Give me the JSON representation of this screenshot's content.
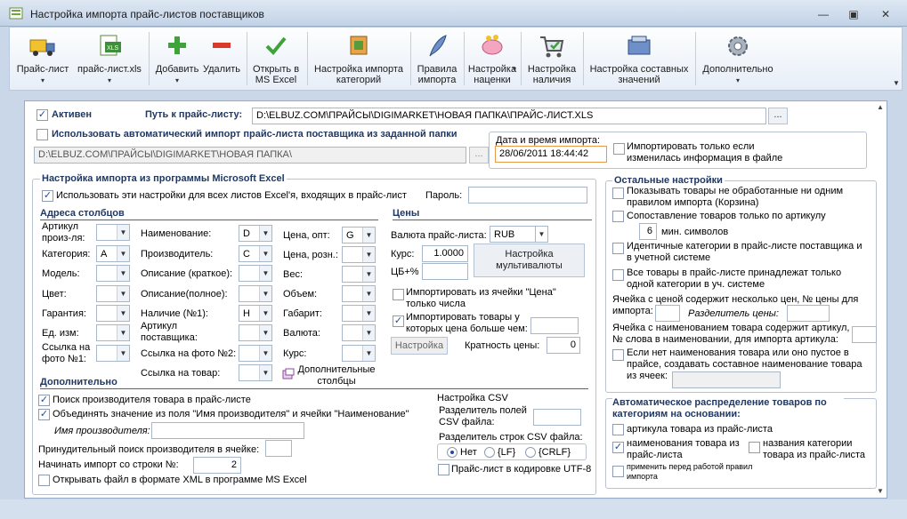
{
  "window": {
    "title": "Настройка импорта прайс-листов поставщиков",
    "min": "—",
    "restore": "▣",
    "close": "✕"
  },
  "toolbar": {
    "items": [
      {
        "label": "Прайс-лист",
        "arrow": "▾",
        "icon": "truck-icon"
      },
      {
        "label": "прайс-лист.xls",
        "arrow": "▾",
        "icon": "excel-icon"
      },
      {
        "label": "Добавить",
        "arrow": "▾",
        "icon": "plus-icon"
      },
      {
        "label": "Удалить",
        "arrow": "",
        "icon": "minus-icon"
      },
      {
        "label": "Открыть в MS Excel",
        "arrow": "",
        "icon": "check-icon"
      },
      {
        "label": "Настройка импорта категорий",
        "arrow": "",
        "icon": "categories-icon"
      },
      {
        "label": "Правила импорта",
        "arrow": "",
        "icon": "feather-icon"
      },
      {
        "label": "Настройка наценки",
        "arrow": "▾",
        "icon": "piggy-bank-icon"
      },
      {
        "label": "Настройка наличия",
        "arrow": "",
        "icon": "cart-icon"
      },
      {
        "label": "Настройка составных значений",
        "arrow": "",
        "icon": "wallet-icon"
      },
      {
        "label": "Дополнительно",
        "arrow": "▾",
        "icon": "gear-icon"
      }
    ]
  },
  "top": {
    "active_label": "Активен",
    "path_label": "Путь к прайс-листу:",
    "path_value": "D:\\ELBUZ.COM\\ПРАЙСЫ\\DIGIMARKET\\НОВАЯ ПАПКА\\ПРАЙС-ЛИСТ.XLS",
    "browse": "...",
    "auto_import_label": "Использовать автоматический импорт прайс-листа поставщика из заданной папки",
    "folder_value": "D:\\ELBUZ.COM\\ПРАЙСЫ\\DIGIMARKET\\НОВАЯ ПАПКА\\",
    "datetime_label": "Дата и время импорта:",
    "datetime_value": "28/06/2011 18:44:42",
    "only_changed_label": "Импортировать только если изменилась информация в файле"
  },
  "excel": {
    "title": "Настройка импорта из программы Microsoft Excel",
    "use_for_all_label": "Использовать эти настройки для всех листов Excel'я, входящих в прайс-лист",
    "password_label": "Пароль:",
    "addresses_title": "Адреса столбцов",
    "fields": {
      "article": "Артикул произ-ля:",
      "category": "Категория:",
      "category_val": "A",
      "model": "Модель:",
      "color": "Цвет:",
      "warranty": "Гарантия:",
      "unit": "Ед. изм:",
      "photo_link": "Ссылка на фото №1:",
      "name": "Наименование:",
      "name_val": "D",
      "manufacturer": "Производитель:",
      "manufacturer_val": "C",
      "desc_short": "Описание (краткое):",
      "desc_full": "Описание(полное):",
      "availability": "Наличие (№1):",
      "availability_val": "H",
      "supplier_article": "Артикул поставщика:",
      "photo_link2": "Ссылка на фото №2:",
      "product_link": "Ссылка на товар:",
      "price_opt": "Цена, опт:",
      "price_opt_val": "G",
      "price_retail": "Цена, розн.:",
      "weight": "Вес:",
      "volume": "Объем:",
      "dimensions": "Габарит:",
      "currency": "Валюта:",
      "rate": "Курс:",
      "extra_columns": "Дополнительные столбцы"
    },
    "prices": {
      "title": "Цены",
      "currency_label": "Валюта прайс-листа:",
      "currency_value": "RUB",
      "rate_label": "Курс:",
      "rate_value": "1.0000",
      "cb_label": "ЦБ+%",
      "multi_currency_button": "Настройка мультивалюты",
      "import_from_cell_label": "Импортировать из ячейки \"Цена\" только числа",
      "import_price_gt_label": "Импортировать товары у которых цена больше чем:",
      "setting_button": "Настройка",
      "multiplicity_label": "Кратность цены:",
      "multiplicity_value": "0"
    }
  },
  "additional": {
    "title": "Дополнительно",
    "find_manufacturer_label": "Поиск производителя товара в прайс-листе",
    "merge_label": "Объединять значение из поля \"Имя производителя\" и ячейки \"Наименование\"",
    "manufacturer_name_label": "Имя производителя:",
    "forced_search_label": "Принудительный поиск производителя в ячейке:",
    "start_row_label": "Начинать импорт со строки №:",
    "start_row_value": "2",
    "xml_label": "Открывать файл в формате XML в программе MS Excel"
  },
  "csv": {
    "title": "Настройка CSV",
    "field_sep_label": "Разделитель полей CSV файла:",
    "row_sep_label": "Разделитель строк CSV файла:",
    "opt_none": "Нет",
    "opt_lf": "{LF}",
    "opt_crlf": "{CRLF}",
    "utf8_label": "Прайс-лист в кодировке UTF-8"
  },
  "other": {
    "title": "Остальные настройки",
    "show_unprocessed_label": "Показывать товары не обработанные ни одним правилом импорта (Корзина)",
    "match_article_label": "Сопоставление товаров только по артикулу",
    "min_symbols_value": "6",
    "min_symbols_label": "мин. символов",
    "identical_categories_label": "Идентичные категории в прайс-листе поставщика и в учетной системе",
    "all_one_category_label": "Все товары в прайс-листе принадлежат только одной категории в уч. системе",
    "multi_price_label": "Ячейка с ценой содержит несколько цен, № цены для импорта:",
    "price_separator_label": "Разделитель цены:",
    "name_contains_article_label": "Ячейка с наименованием товара содержит артикул, № слова в наименовании, для импорта артикула:",
    "composite_name_label": "Если нет наименования товара или оно пустое в прайсе, создавать составное наименование товара из ячеек:"
  },
  "auto_distribution": {
    "title": "Автоматическое распределение товаров по категориям на основании:",
    "by_article_label": "артикула товара из прайс-листа",
    "by_name_label": "наименования товара из прайс-листа",
    "by_category_names_label": "названия категории товара из прайс-листа",
    "apply_before_rules_label": "применить перед работой правил импорта"
  }
}
